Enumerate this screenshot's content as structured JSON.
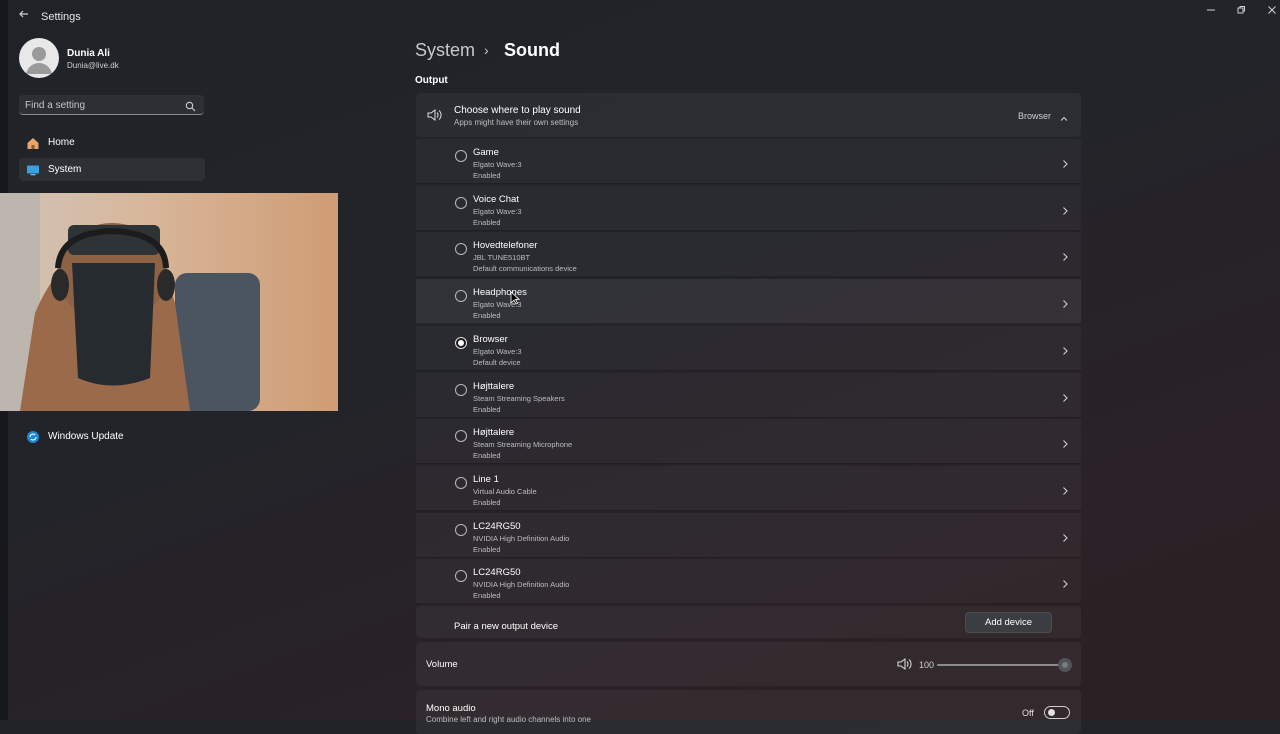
{
  "window": {
    "title": "Settings",
    "back_icon": "back-arrow-icon",
    "controls": [
      "minimize-icon",
      "restore-icon",
      "close-icon"
    ]
  },
  "user": {
    "name": "Dunia Ali",
    "email": "Dunia@live.dk"
  },
  "search": {
    "placeholder": "Find a setting"
  },
  "nav": {
    "items": [
      {
        "label": "Home",
        "icon": "home-icon"
      },
      {
        "label": "System",
        "icon": "system-display-icon",
        "selected": true
      },
      {
        "label": "Windows Update",
        "icon": "windows-update-icon"
      }
    ]
  },
  "breadcrumb": {
    "parent": "System",
    "separator": "›",
    "current": "Sound"
  },
  "output": {
    "section_label": "Output",
    "header_title": "Choose where to play sound",
    "header_subtitle": "Apps might have their own settings",
    "header_value": "Browser",
    "devices": [
      {
        "name": "Game",
        "model": "Elgato Wave:3",
        "status": "Enabled",
        "selected": false
      },
      {
        "name": "Voice Chat",
        "model": "Elgato Wave:3",
        "status": "Enabled",
        "selected": false
      },
      {
        "name": "Hovedtelefoner",
        "model": "JBL TUNE510BT",
        "status": "Default communications device",
        "selected": false
      },
      {
        "name": "Headphones",
        "model": "Elgato Wave:3",
        "status": "Enabled",
        "selected": false
      },
      {
        "name": "Browser",
        "model": "Elgato Wave:3",
        "status": "Default device",
        "selected": true
      },
      {
        "name": "Højttalere",
        "model": "Steam Streaming Speakers",
        "status": "Enabled",
        "selected": false
      },
      {
        "name": "Højttalere",
        "model": "Steam Streaming Microphone",
        "status": "Enabled",
        "selected": false
      },
      {
        "name": "Line 1",
        "model": "Virtual Audio Cable",
        "status": "Enabled",
        "selected": false
      },
      {
        "name": "LC24RG50",
        "model": "NVIDIA High Definition Audio",
        "status": "Enabled",
        "selected": false
      },
      {
        "name": "LC24RG50",
        "model": "NVIDIA High Definition Audio",
        "status": "Enabled",
        "selected": false
      }
    ],
    "pair_label": "Pair a new output device",
    "add_button": "Add device"
  },
  "volume": {
    "label": "Volume",
    "value": "100",
    "level_percent": 100
  },
  "mono": {
    "title": "Mono audio",
    "subtitle": "Combine left and right audio channels into one",
    "state": "Off"
  },
  "colors": {
    "accent": "#0078d4",
    "background": "#202326"
  }
}
